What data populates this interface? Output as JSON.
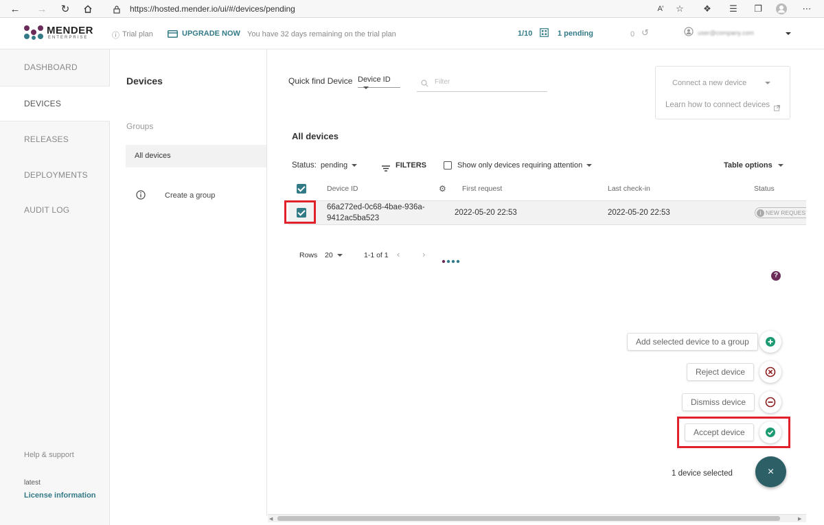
{
  "browser": {
    "url": "https://hosted.mender.io/ui/#/devices/pending"
  },
  "header": {
    "brand": "MENDER",
    "brand_sub": "ENTERPRISE",
    "trial_plan": "Trial plan",
    "upgrade": "UPGRADE NOW",
    "trial_remaining": "You have 32 days remaining on the trial plan",
    "device_count": "1/10",
    "pending": "1 pending",
    "deploy_count": "0",
    "user_email": "user@company.com"
  },
  "sidebar": {
    "items": [
      "DASHBOARD",
      "DEVICES",
      "RELEASES",
      "DEPLOYMENTS",
      "AUDIT LOG"
    ],
    "help": "Help & support",
    "version": "latest",
    "license": "License information"
  },
  "groups": {
    "title": "Devices",
    "heading": "Groups",
    "all_devices": "All devices",
    "create_group": "Create a group"
  },
  "toolbar": {
    "quick_find_label": "Quick find Device",
    "quick_find_field": "Device ID",
    "filter_placeholder": "Filter",
    "connect_device": "Connect a new device",
    "learn_connect": "Learn how to connect devices"
  },
  "list": {
    "title": "All devices",
    "status_label": "Status:",
    "status_value": "pending",
    "filters": "FILTERS",
    "attention": "Show only devices requiring attention",
    "table_options": "Table options",
    "columns": [
      "Device ID",
      "First request",
      "Last check-in",
      "Status"
    ],
    "rows": [
      {
        "device_id_line1": "66a272ed-0c68-4bae-936a-",
        "device_id_line2": "9412ac5ba523",
        "first_request": "2022-05-20 22:53",
        "last_checkin": "2022-05-20 22:53",
        "status": "NEW REQUEST"
      }
    ],
    "rows_label": "Rows",
    "rows_value": "20",
    "page_range": "1-1 of 1"
  },
  "actions": {
    "add_to_group": "Add selected device to a group",
    "reject": "Reject device",
    "dismiss": "Dismiss device",
    "accept": "Accept device",
    "selected_count": "1 device selected",
    "close": "×"
  },
  "colors": {
    "accent": "#337a87",
    "accept": "#1c9a72",
    "reject": "#8b1c1c",
    "fab": "#2c5f66",
    "highlight": "#e0202a"
  }
}
